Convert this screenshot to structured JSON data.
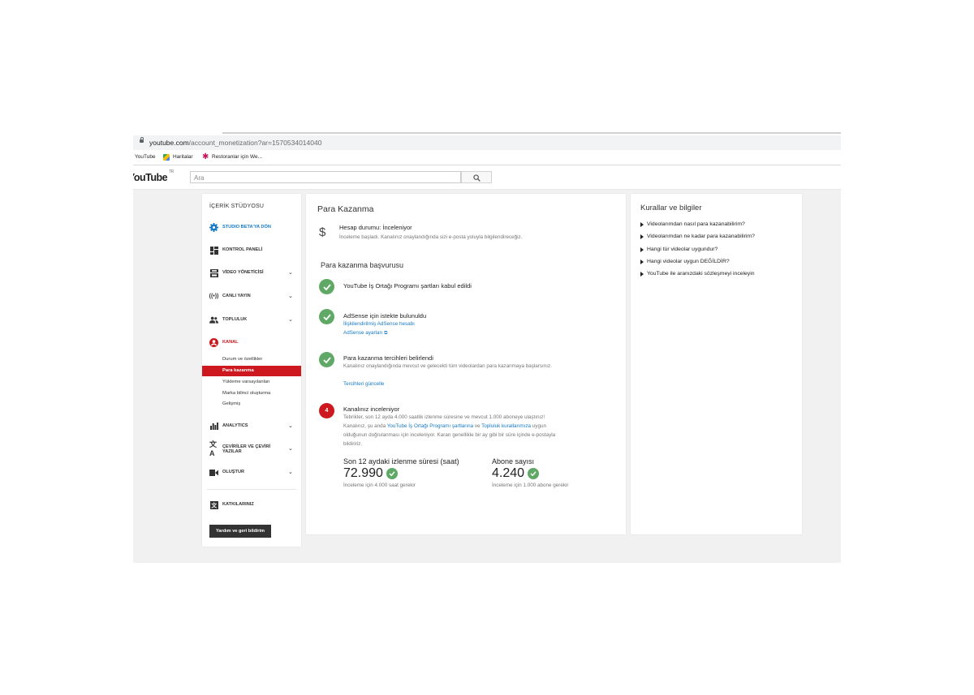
{
  "browser": {
    "url_host": "youtube.com",
    "url_path": "/account_monetization?ar=1570534014040",
    "bookmarks": [
      {
        "label": "YouTube",
        "icon": "none"
      },
      {
        "label": "Haritalar",
        "icon": "maps-icon"
      },
      {
        "label": "Restoranlar için We...",
        "icon": "restaurant-icon"
      }
    ]
  },
  "header": {
    "logo": "YouTube",
    "region": "TR",
    "search_placeholder": "Ara"
  },
  "sidebar": {
    "heading": "İÇERİK STÜDYOSU",
    "studio_beta": "STUDIO BETA'YA DÖN",
    "items": [
      {
        "label": "KONTROL PANELİ",
        "icon": "dashboard-icon"
      },
      {
        "label": "VİDEO YÖNETİCİSİ",
        "icon": "video-manager-icon"
      },
      {
        "label": "CANLI YAYIN",
        "icon": "live-icon"
      },
      {
        "label": "TOPLULUK",
        "icon": "community-icon"
      },
      {
        "label": "KANAL",
        "icon": "channel-icon"
      }
    ],
    "channel_subitems": [
      "Durum ve özellikler",
      "Para kazanma",
      "Yükleme varsayılanları",
      "Marka bilinci oluşturma",
      "Gelişmiş"
    ],
    "lower_items": [
      {
        "label": "ANALYTICS",
        "icon": "analytics-icon"
      },
      {
        "label": "ÇEVİRİLER VE ÇEVİRİ YAZILAR",
        "icon": "translate-icon"
      },
      {
        "label": "OLUŞTUR",
        "icon": "create-icon"
      }
    ],
    "contributions": "KATKILARINIZ",
    "help_button": "Yardım ve geri bildirim",
    "accent": "#cc181e"
  },
  "main": {
    "title": "Para Kazanma",
    "status_label": "Hesap durumu: İnceleniyor",
    "status_desc": "İnceleme başladı. Kanalınız onaylandığında sizi e-posta yoluyla bilgilendireceğiz.",
    "apply_title": "Para kazanma başvurusu",
    "step1": "YouTube İş Ortağı Programı şartları kabul edildi",
    "step2_title": "AdSense için istekte bulunuldu",
    "step2_link1": "İlişkilendirilmiş AdSense hesabı",
    "step2_link2": "AdSense ayarları",
    "step3_title": "Para kazanma tercihleri belirlendi",
    "step3_text": "Kanalınız onaylandığında mevcut ve gelecekti tüm videolardan para kazanmaya başlarsınız.",
    "step3_link": "Tercihleri güncelle",
    "step4_number": "4",
    "step4_title": "Kanalınız inceleniyor",
    "step4_text_a": "Tebrikler, son 12 ayda 4.000 saatlik izlenme süresine ve mevcut 1.000 aboneye ulaştınız! Kanalınız, şu anda ",
    "step4_link1": "YouTube İş Ortağı Programı şartlarına",
    "step4_text_b": " ve ",
    "step4_link2": "Topluluk kurallarımıza",
    "step4_text_c": " uygun olduğunun doğrulanması için inceleniyor. Kararı genellikle bir ay gibi bir süre içinde e-postayla bildiririz.",
    "watch_label": "Son 12 aydaki izlenme süresi (saat)",
    "watch_value": "72.990",
    "watch_note": "İnceleme için 4.000 saat gerekir",
    "subs_label": "Abone sayısı",
    "subs_value": "4.240",
    "subs_note": "İnceleme için 1.000 abone gerekir",
    "check_color": "#5fa865",
    "link_color": "#167ac6"
  },
  "right": {
    "title": "Kurallar ve bilgiler",
    "links": [
      "Videolarımdan nasıl para kazanabilirim?",
      "Videolarımdan ne kadar para kazanabilirim?",
      "Hangi tür videolar uygundur?",
      "Hangi videolar uygun DEĞİLDİR?",
      "YouTube ile aranızdaki sözleşmeyi inceleyin"
    ]
  }
}
